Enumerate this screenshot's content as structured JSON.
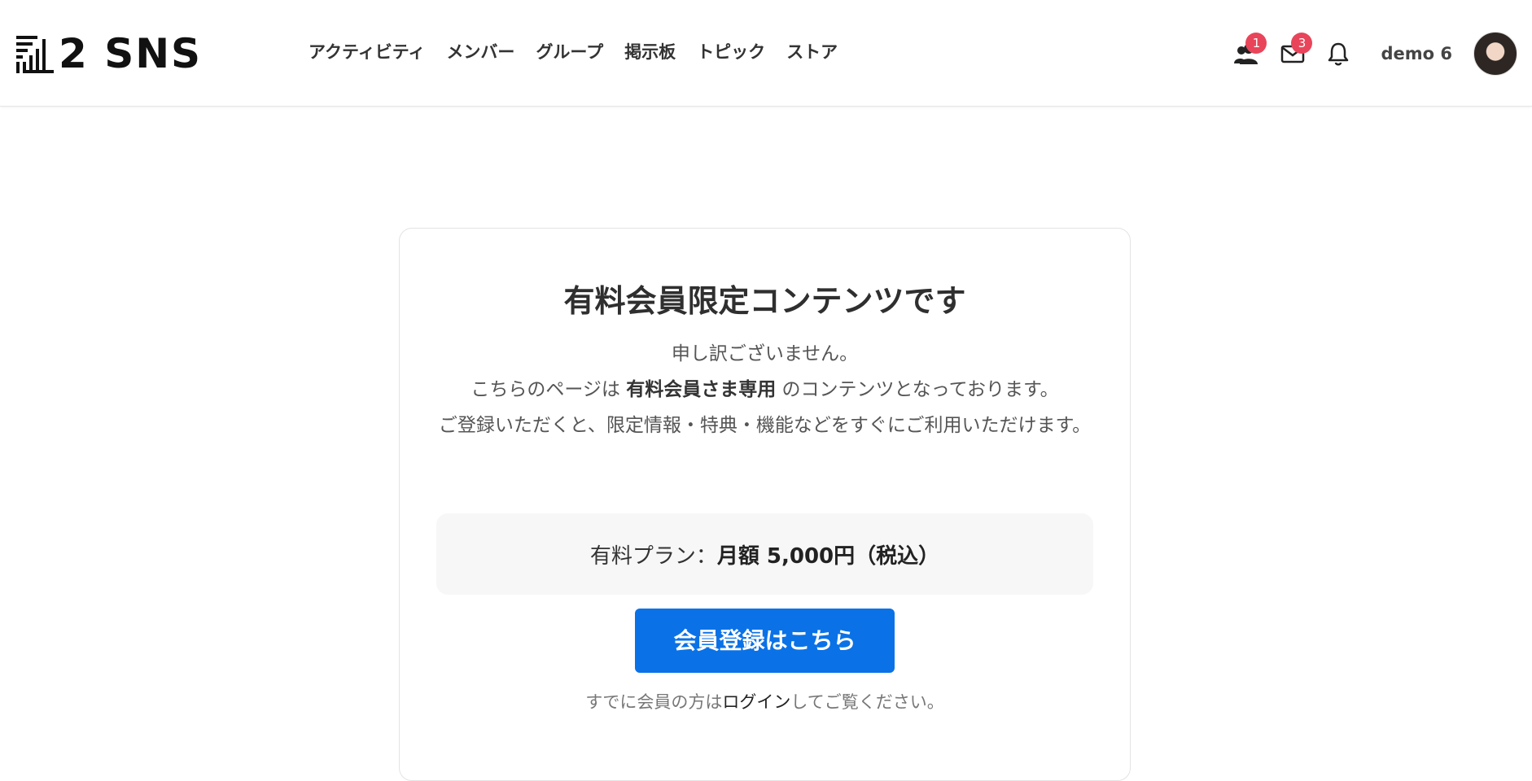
{
  "brand": {
    "name": "2 SNS"
  },
  "nav": {
    "items": [
      {
        "label": "アクティビティ"
      },
      {
        "label": "メンバー"
      },
      {
        "label": "グループ"
      },
      {
        "label": "掲示板"
      },
      {
        "label": "トピック"
      },
      {
        "label": "ストア"
      }
    ]
  },
  "header_right": {
    "friends_badge": "1",
    "messages_badge": "3",
    "username": "demo 6",
    "icons": [
      "friends-icon",
      "mail-icon",
      "bell-icon"
    ]
  },
  "card": {
    "title": "有料会員限定コンテンツです",
    "line1": "申し訳ございません。",
    "line2_pre": "こちらのページは ",
    "line2_bold": "有料会員さま専用",
    "line2_post": " のコンテンツとなっております。",
    "line3": "ご登録いただくと、限定情報・特典・機能などをすぐにご利用いただけます。",
    "plan_label": "有料プラン：",
    "plan_value": "月額 5,000円（税込）",
    "signup_button": "会員登録はこちら",
    "login_pre": "すでに会員の方は",
    "login_link": "ログイン",
    "login_post": "してご覧ください。"
  },
  "colors": {
    "primary": "#0a72e6",
    "badge": "#e8455a",
    "plan_bg": "#f7f7f7"
  }
}
